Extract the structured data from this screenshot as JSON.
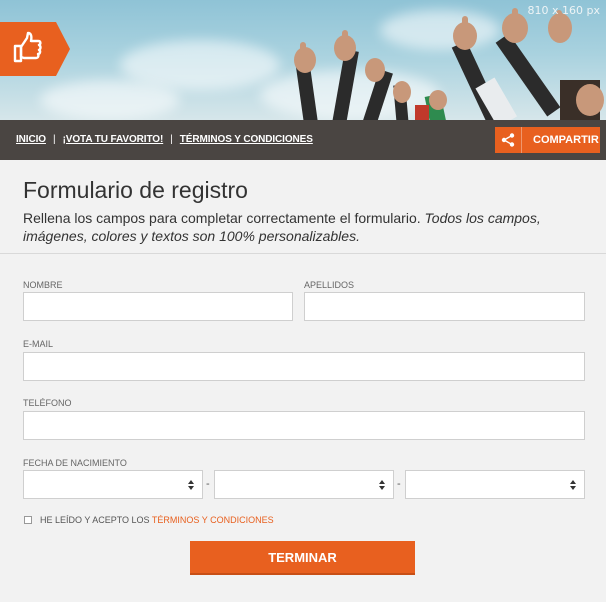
{
  "banner": {
    "size_label": "810 x 160 px"
  },
  "nav": {
    "items": [
      {
        "label": "INICIO"
      },
      {
        "label": "¡VOTA TU FAVORITO!"
      },
      {
        "label": "TÉRMINOS Y CONDICIONES"
      }
    ],
    "separator": "|",
    "share_label": "COMPARTIR"
  },
  "page": {
    "title": "Formulario de registro",
    "intro_plain": "Rellena los campos para completar correctamente el formulario. ",
    "intro_italic": "Todos los campos, imágenes, colores y textos son 100% personalizables."
  },
  "form": {
    "nombre_label": "NOMBRE",
    "apellidos_label": "APELLIDOS",
    "email_label": "E-MAIL",
    "telefono_label": "TELÉFONO",
    "fecha_label": "FECHA DE NACIMIENTO",
    "date_separator": "-",
    "terms_prefix": "HE LEÍDO Y ACEPTO LOS ",
    "terms_link": "TÉRMINOS Y CONDICIONES",
    "submit_label": "TERMINAR"
  },
  "colors": {
    "accent": "#e8601f",
    "navbar": "#4a4542"
  },
  "icons": {
    "logo": "thumbs-up-icon",
    "share": "share-icon"
  }
}
